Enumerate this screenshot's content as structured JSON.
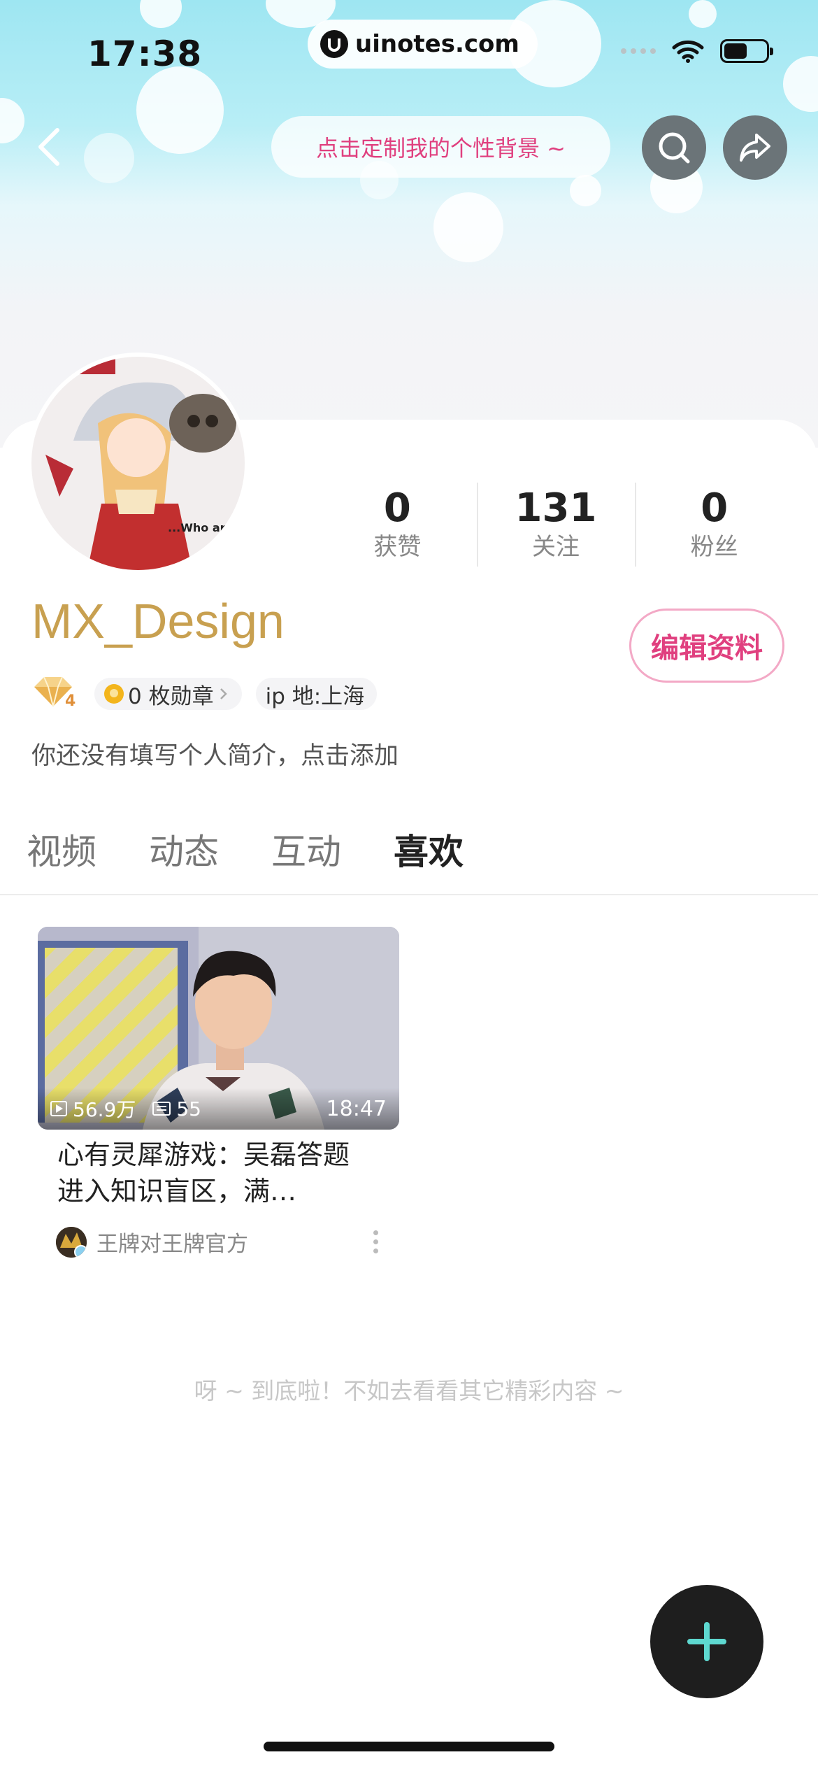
{
  "status_bar": {
    "time": "17:38",
    "url": "uinotes.com"
  },
  "header": {
    "customize_bg_label": "点击定制我的个性背景 ~",
    "icons": [
      "back-icon",
      "search-icon",
      "share-icon"
    ]
  },
  "profile": {
    "username": "MX_Design",
    "level": "4",
    "medals_label": "0 枚勋章",
    "ip_label": "ip 地:上海",
    "bio": "你还没有填写个人简介，点击添加",
    "edit_label": "编辑资料",
    "stats": [
      {
        "value": "0",
        "label": "获赞"
      },
      {
        "value": "131",
        "label": "关注"
      },
      {
        "value": "0",
        "label": "粉丝"
      }
    ]
  },
  "tabs": [
    {
      "label": "视频",
      "active": false
    },
    {
      "label": "动态",
      "active": false
    },
    {
      "label": "互动",
      "active": false
    },
    {
      "label": "喜欢",
      "active": true
    }
  ],
  "videos": [
    {
      "views": "56.9万",
      "danmaku": "55",
      "duration": "18:47",
      "title": "心有灵犀游戏：吴磊答题进入知识盲区，满…",
      "author": "王牌对王牌官方"
    }
  ],
  "end_text": "呀 ~ 到底啦！不如去看看其它精彩内容 ~",
  "colors": {
    "accent_pink": "#e0407f",
    "username_gold": "#c8a050",
    "fab_plus": "#5ed8d0"
  }
}
